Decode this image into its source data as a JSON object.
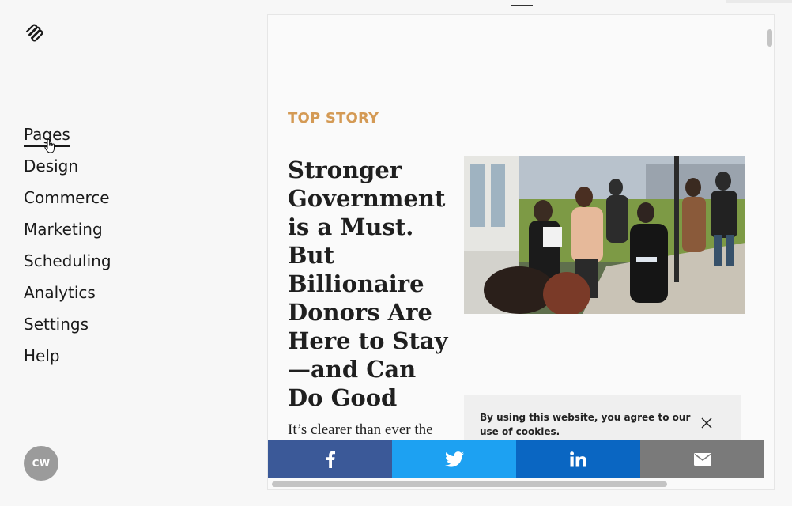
{
  "app": {
    "logo_icon": "squarespace-logo-icon"
  },
  "sidebar": {
    "items": [
      {
        "label": "Pages",
        "active": true
      },
      {
        "label": "Design"
      },
      {
        "label": "Commerce"
      },
      {
        "label": "Marketing"
      },
      {
        "label": "Scheduling"
      },
      {
        "label": "Analytics"
      },
      {
        "label": "Settings"
      },
      {
        "label": "Help"
      }
    ],
    "avatar_initials": "CW"
  },
  "preview": {
    "kicker": "TOP STORY",
    "headline": "Stronger Government is a Must. But Billionaire Donors Are Here to Stay —and Can Do Good",
    "dek": "It’s clearer than ever the",
    "cookie_notice": "By using this website, you agree to our use of cookies.",
    "share_icons": [
      "facebook-icon",
      "twitter-icon",
      "linkedin-icon",
      "email-icon"
    ]
  },
  "colors": {
    "kicker": "#d49a55",
    "facebook": "#3b5998",
    "twitter": "#1da1f2",
    "linkedin": "#0a66c2",
    "email": "#7a7a7a"
  }
}
